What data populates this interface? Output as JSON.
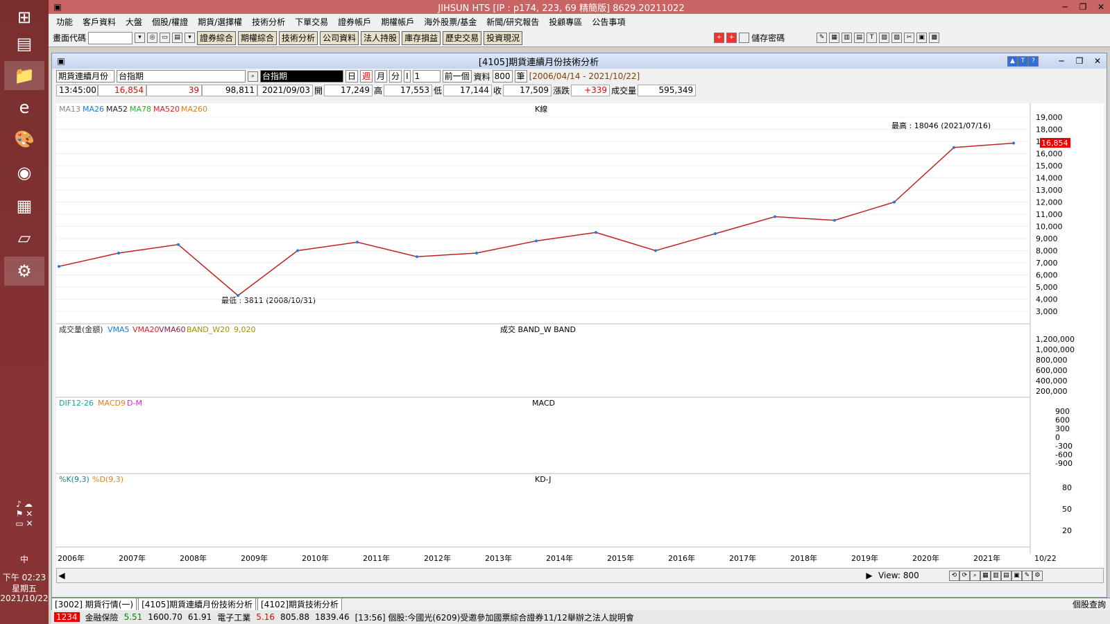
{
  "window": {
    "title": "JIHSUN HTS    [IP : p174, 223, 69 精簡版] 8629.20211022"
  },
  "menu": [
    "功能",
    "客戶資料",
    "大盤",
    "個股/權證",
    "期貨/選擇權",
    "技術分析",
    "下單交易",
    "證券帳戶",
    "期權帳戶",
    "海外股票/基金",
    "新聞/研究報告",
    "投顧專區",
    "公告事項"
  ],
  "toolbar": {
    "code_label": "畫面代碼",
    "buttons": [
      "證券綜合",
      "期權綜合",
      "技術分析",
      "公司資料",
      "法人持股",
      "庫存損益",
      "歷史交易",
      "投資現況"
    ],
    "save_pwd": "儲存密碼"
  },
  "inner": {
    "title": "[4105]期貨連續月份技術分析"
  },
  "controls": {
    "product": "期貨連續月份",
    "symbol": "台指期",
    "name": "台指期",
    "periods": [
      "日",
      "週",
      "月",
      "分"
    ],
    "active_period": "週",
    "n": "1",
    "prev": "前一個",
    "data_label": "資料",
    "data_val": "800",
    "data_unit": "筆",
    "range": "[2006/04/14 - 2021/10/22]"
  },
  "quote": {
    "time": "13:45:00",
    "price": "16,854",
    "change": "39",
    "volume": "98,811",
    "date": "2021/09/03",
    "open_l": "開",
    "open": "17,249",
    "high_l": "高",
    "high": "17,553",
    "low_l": "低",
    "low": "17,144",
    "close_l": "收",
    "close": "17,509",
    "chg_l": "漲跌",
    "chg": "+339",
    "vol_l": "成交量",
    "vol": "595,349"
  },
  "chart": {
    "ma_legend": [
      "MA13",
      "MA26",
      "MA52",
      "MA78",
      "MA520",
      "MA260"
    ],
    "k_title": "K線",
    "high_note": "最高 : 18046 (2021/07/16)",
    "low_note": "最低 : 3811 (2008/10/31)",
    "last": "16,854",
    "price_ticks": [
      "19,000",
      "18,000",
      "17,000",
      "16,000",
      "15,000",
      "14,000",
      "13,000",
      "12,000",
      "11,000",
      "10,000",
      "9,000",
      "8,000",
      "7,000",
      "6,000",
      "5,000",
      "4,000",
      "3,000"
    ],
    "vol_legend": [
      "成交量(金額)",
      "VMA5",
      "VMA20",
      "VMA60",
      "BAND_W20",
      "9,020"
    ],
    "vol_title": "成交   BAND_W   BAND",
    "vol_ticks": [
      "1,200,000",
      "1,000,000",
      "800,000",
      "600,000",
      "400,000",
      "200,000"
    ],
    "macd_legend": [
      "DIF12-26",
      "MACD9",
      "D-M"
    ],
    "macd_title": "MACD",
    "macd_ticks": [
      "900",
      "600",
      "300",
      "0",
      "-300",
      "-600",
      "-900"
    ],
    "kd_legend": [
      "%K(9,3)",
      "%D(9,3)"
    ],
    "kd_title": "KD-J",
    "kd_ticks": [
      "80",
      "50",
      "20"
    ],
    "x_labels": [
      "2006年",
      "2007年",
      "2008年",
      "2009年",
      "2010年",
      "2011年",
      "2012年",
      "2013年",
      "2014年",
      "2015年",
      "2016年",
      "2017年",
      "2018年",
      "2019年",
      "2020年",
      "2021年",
      "10/22"
    ]
  },
  "chart_data": {
    "type": "line",
    "title": "K線",
    "x": [
      "2006",
      "2007",
      "2008",
      "2009",
      "2010",
      "2011",
      "2012",
      "2013",
      "2014",
      "2015",
      "2016",
      "2017",
      "2018",
      "2019",
      "2020",
      "2021",
      "2021/10/22"
    ],
    "series": [
      {
        "name": "price",
        "values": [
          6700,
          7800,
          8500,
          4300,
          8000,
          8700,
          7500,
          7800,
          8800,
          9500,
          8000,
          9400,
          10800,
          10500,
          12000,
          16500,
          16854
        ]
      }
    ],
    "ylim": [
      3000,
      19000
    ],
    "annotations": [
      "最高 : 18046 (2021/07/16)",
      "最低 : 3811 (2008/10/31)"
    ]
  },
  "scroll": {
    "view_label": "View:",
    "view": "800"
  },
  "tabs": [
    "[3002] 期貨行情(一)",
    "[4105]期貨連續月份技術分析",
    "[4102]期貨技術分析"
  ],
  "right_tab": "個股查詢",
  "statusbar": {
    "item1": "金融保險",
    "v1": "5.51",
    "v1b": "1600.70",
    "v1c": "61.91",
    "item2": "電子工業",
    "v2": "5.16",
    "v2b": "805.88",
    "v2c": "1839.46",
    "news": "[13:56]  個股:今國光(6209)受邀參加國票綜合證券11/12舉辦之法人說明會"
  },
  "clock": {
    "time": "下午 02:23",
    "day": "星期五",
    "date": "2021/10/22",
    "ime": "中"
  }
}
